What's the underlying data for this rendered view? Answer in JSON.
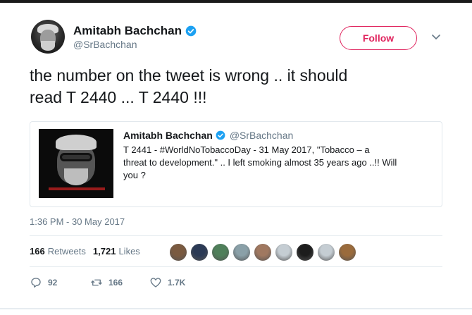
{
  "author": {
    "name": "Amitabh Bachchan",
    "handle": "@SrBachchan",
    "verified_icon": "verified-badge-icon"
  },
  "follow_button": {
    "label": "Follow"
  },
  "more_menu": {
    "icon": "chevron-down-icon"
  },
  "tweet": {
    "text_lines": [
      "the number on the tweet is wrong .. it should",
      "read T 2440 ... T 2440 !!!"
    ]
  },
  "quoted_tweet": {
    "author_name": "Amitabh Bachchan",
    "author_handle": "@SrBachchan",
    "text_lines": [
      "T 2441 - #WorldNoTobaccoDay -    31 May 2017, \"Tobacco – a",
      "threat to development.\" .. I left smoking almost 35 years ago ..!! Will",
      "you ?"
    ]
  },
  "timestamp": "1:36 PM - 30 May 2017",
  "stats": {
    "retweets_count": "166",
    "retweets_label": "Retweets",
    "likes_count": "1,721",
    "likes_label": "Likes"
  },
  "liker_avatar_colors": [
    "#7a5a40",
    "#2b3a55",
    "#4f7f5a",
    "#8aa0a8",
    "#a07860",
    "#c5cdd3",
    "#1d1d1d",
    "#c5cdd3",
    "#9a6b3c"
  ],
  "actions": {
    "reply_count": "92",
    "retweet_count": "166",
    "like_count": "1.7K"
  },
  "colors": {
    "accent_follow": "#e0245e",
    "verified_blue": "#1da1f2",
    "muted_text": "#657786"
  }
}
